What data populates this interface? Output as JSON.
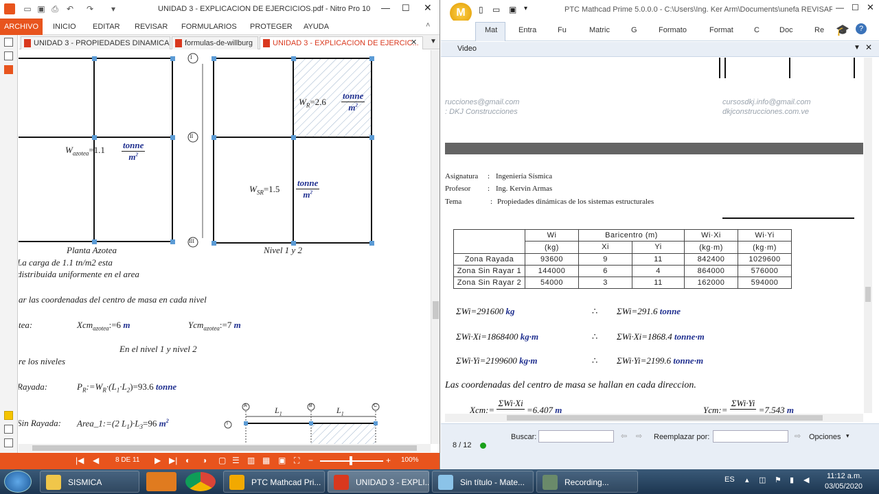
{
  "nitro": {
    "title": "UNIDAD 3 - EXPLICACION DE EJERCICIOS.pdf - Nitro Pro 10",
    "ribbon_tabs": [
      "ARCHIVO",
      "INICIO",
      "EDITAR",
      "REVISAR",
      "FORMULARIOS",
      "PROTEGER",
      "AYUDA"
    ],
    "doc_tabs": [
      "UNIDAD 3 - PROPIEDADES DINAMICAS ...",
      "formulas-de-willburg",
      "UNIDAD 3 - EXPLICACION DE EJERCIC..."
    ],
    "page_indicator": "8 DE 11",
    "zoom": "100%",
    "content": {
      "w_azotea_lhs": "W",
      "w_azotea_sub": "azotea",
      "w_azotea_val": "=1.1",
      "unit_num": "tonne",
      "unit_den": "m",
      "w_r_lhs": "W",
      "w_r_sub": "R",
      "w_r_val": "=2.6",
      "w_sr_lhs": "W",
      "w_sr_sub": "SR",
      "w_sr_val": "=1.5",
      "grid_labels": [
        "I",
        "II",
        "III"
      ],
      "caption_azotea": "Planta Azotea",
      "caption_nivel": "Nivel 1 y 2",
      "line1": "La carga de 1.1 tn/m2 esta",
      "line2": "distribuida uniformente en el area",
      "line3": "ar las coordenadas del centro de masa en cada nivel",
      "tea": "tea:",
      "xcm": "Xcm",
      "xcm_sub": "azotea",
      "xcm_val": ":=6",
      "xcm_unit": "m",
      "ycm": "Ycm",
      "ycm_sub": "azotea",
      "ycm_val": ":=7",
      "ycm_unit": "m",
      "en_nivel": "En el nivel 1 y nivel 2",
      "re_niveles": "re los niveles",
      "rayada": "Rayada:",
      "pr_expr": "P",
      "pr_sub": "R",
      "pr_rhs": ":=W",
      "pr_rhs_sub": "R",
      "pr_rest": "·(L",
      "pr_l1sub": "1",
      "pr_mid": "·L",
      "pr_l2sub": "2",
      "pr_end": ")=93.6",
      "pr_unit": "tonne",
      "sin_rayada": "Sin Rayada:",
      "area_expr": "Area_1:=(2 L",
      "area_l1": "1",
      "area_mid": ")·L",
      "area_l3": "3",
      "area_end": "=96",
      "area_unit": "m",
      "area_exp": "2",
      "axis_labels": [
        "A",
        "B",
        "C"
      ],
      "dim_L": "L",
      "dim_sub": "1",
      "row_label": "I"
    }
  },
  "mathcad": {
    "title": "PTC Mathcad Prime 5.0.0.0 - C:\\Users\\Ing. Ker Arm\\Documents\\unefa REVISAR",
    "ribbon_tabs": [
      "Mat",
      "Entra",
      "Fu",
      "Matric",
      "G",
      "Formato",
      "Format",
      "C",
      "Doc",
      "Re"
    ],
    "video_label": "Video",
    "wm_left1": "rucciones@gmail.com",
    "wm_left2": ": DKJ Construcciones",
    "wm_right1": "cursosdkj.info@gmail.com",
    "wm_right2": "dkjconstrucciones.com.ve",
    "asignatura_label": "Asignatura",
    "asignatura": "Ingeniería Sísmica",
    "profesor_label": "Profesor",
    "profesor": "Ing. Kervin Armas",
    "tema_label": "Tema",
    "tema": "Propiedades dinámicas de los sistemas estructurales",
    "table": {
      "h_wi": "Wi",
      "h_wi_u": "(kg)",
      "h_bari": "Baricentro (m)",
      "h_xi": "Xi",
      "h_yi": "Yi",
      "h_wixi": "Wi·Xi",
      "h_wiyi": "Wi·Yi",
      "h_kgm": "(kg·m)",
      "rows": [
        {
          "zona": "Zona Rayada",
          "wi": "93600",
          "xi": "9",
          "yi": "11",
          "wixi": "842400",
          "wiyi": "1029600"
        },
        {
          "zona": "Zona Sin Rayar 1",
          "wi": "144000",
          "xi": "6",
          "yi": "4",
          "wixi": "864000",
          "wiyi": "576000"
        },
        {
          "zona": "Zona Sin Rayar 2",
          "wi": "54000",
          "xi": "3",
          "yi": "11",
          "wixi": "162000",
          "wiyi": "594000"
        }
      ]
    },
    "sums": [
      {
        "lhs": "ΣWi=291600",
        "unit": "kg",
        "rhs": "ΣWi=291.6",
        "runit": "tonne"
      },
      {
        "lhs": "ΣWi·Xi=1868400",
        "unit": "kg·m",
        "rhs": "ΣWi·Xi=1868.4",
        "runit": "tonne·m"
      },
      {
        "lhs": "ΣWi·Yi=2199600",
        "unit": "kg·m",
        "rhs": "ΣWi·Yi=2199.6",
        "runit": "tonne·m"
      }
    ],
    "therefore": "∴",
    "coord_text": "Las coordenadas del centro de masa se hallan en cada direccion.",
    "xcm_lhs": "Xcm:=",
    "xcm_num": "ΣWi·Xi",
    "xcm_val": "=6.407",
    "ycm_lhs": "Ycm:=",
    "ycm_num": "ΣWi·Yi",
    "ycm_val": "=7.543",
    "m_unit": "m",
    "page": "8 / 12",
    "buscar": "Buscar:",
    "reemplazar": "Reemplazar por:",
    "opciones": "Opciones"
  },
  "taskbar": {
    "items": [
      "SISMICA",
      "PTC Mathcad Pri...",
      "UNIDAD 3 - EXPLI...",
      "Sin título - Mate...",
      "Recording..."
    ],
    "lang": "ES",
    "time": "11:12 a.m.",
    "date": "03/05/2020"
  }
}
